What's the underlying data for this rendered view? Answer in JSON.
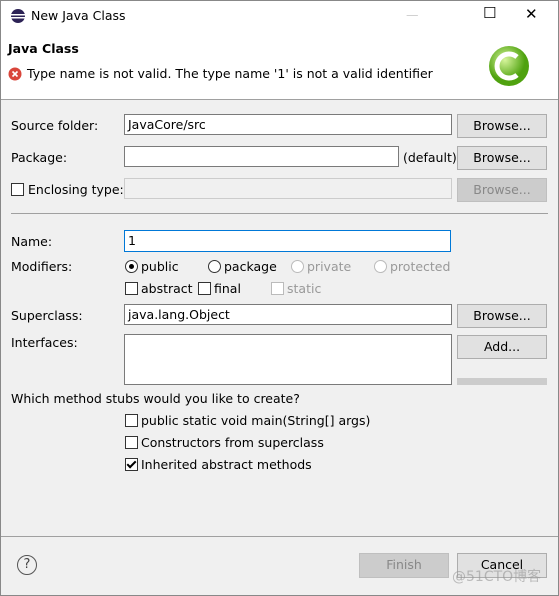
{
  "window": {
    "title": "New Java Class",
    "minimize": "—",
    "maximize": "☐",
    "close": "✕"
  },
  "header": {
    "title": "Java Class",
    "error": "Type name is not valid. The type name '1' is not a valid identifier"
  },
  "form": {
    "source_folder": {
      "label": "Source folder:",
      "value": "JavaCore/src",
      "button": "Browse..."
    },
    "package": {
      "label": "Package:",
      "value": "",
      "hint": "(default)",
      "button": "Browse..."
    },
    "enclosing": {
      "label": "Enclosing type:",
      "value": "",
      "button": "Browse...",
      "checked": false
    },
    "name": {
      "label": "Name:",
      "value": "1"
    },
    "modifiers": {
      "label": "Modifiers:",
      "access": [
        "public",
        "package",
        "private",
        "protected"
      ],
      "selected": "public",
      "other": [
        "abstract",
        "final",
        "static"
      ]
    },
    "superclass": {
      "label": "Superclass:",
      "value": "java.lang.Object",
      "button": "Browse..."
    },
    "interfaces": {
      "label": "Interfaces:",
      "add": "Add..."
    },
    "stubs": {
      "question": "Which method stubs would you like to create?",
      "options": [
        {
          "label": "public static void main(String[] args)",
          "checked": false
        },
        {
          "label": "Constructors from superclass",
          "checked": false
        },
        {
          "label": "Inherited abstract methods",
          "checked": true
        }
      ]
    }
  },
  "footer": {
    "help": "?",
    "finish": "Finish",
    "cancel": "Cancel"
  },
  "watermark": "@51CTO博客",
  "colors": {
    "error": "#d9453a",
    "logo": "#6cc21b",
    "focus": "#0078d7"
  }
}
